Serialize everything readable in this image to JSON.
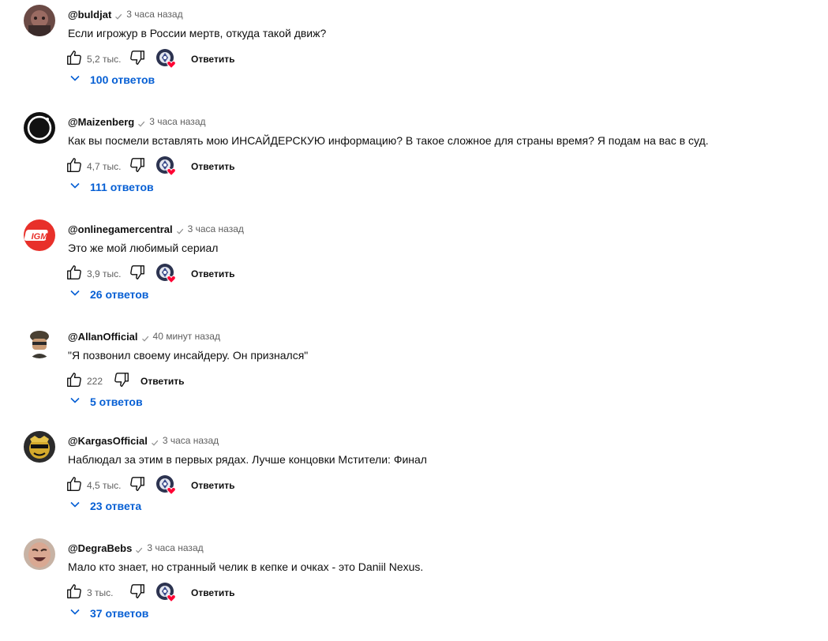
{
  "comments": [
    {
      "author": "@buldjat",
      "time": "3 часа назад",
      "text": "Если игрожур в России мертв, откуда такой движ?",
      "likes": "5,2 тыс.",
      "reply_label": "Ответить",
      "replies_label": "100 ответов",
      "has_heart": true,
      "avatar_icon": "dark-character-avatar"
    },
    {
      "author": "@Maizenberg",
      "time": "3 часа назад",
      "text": "Как вы посмели вставлять мою ИНСАЙДЕРСКУЮ информацию? В такое сложное для страны время? Я подам на вас в суд.",
      "likes": "4,7 тыс.",
      "reply_label": "Ответить",
      "replies_label": "111 ответов",
      "has_heart": true,
      "avatar_icon": "black-ring-avatar"
    },
    {
      "author": "@onlinegamercentral",
      "time": "3 часа назад",
      "text": "Это же мой любимый сериал",
      "likes": "3,9 тыс.",
      "reply_label": "Ответить",
      "replies_label": "26 ответов",
      "has_heart": true,
      "avatar_icon": "igm-logo-avatar"
    },
    {
      "author": "@AllanOfficial",
      "time": "40 минут назад",
      "text": "\"Я позвонил своему инсайдеру. Он признался\"",
      "likes": "222",
      "reply_label": "Ответить",
      "replies_label": "5 ответов",
      "has_heart": false,
      "avatar_icon": "soldier-avatar"
    },
    {
      "author": "@KargasOfficial",
      "time": "3 часа назад",
      "text": "Наблюдал за этим в первых рядах. Лучше концовки Мстители: Финал",
      "likes": "4,5 тыс.",
      "reply_label": "Ответить",
      "replies_label": "23 ответа",
      "has_heart": true,
      "avatar_icon": "cartoon-face-avatar"
    },
    {
      "author": "@DegraBebs",
      "time": "3 часа назад",
      "text": "Мало кто знает, но странный челик в кепке и очках - это Daniil Nexus.",
      "likes": "3 тыс.",
      "reply_label": "Ответить",
      "replies_label": "37 ответов",
      "has_heart": true,
      "avatar_icon": "laughing-face-avatar"
    }
  ],
  "colors": {
    "replies": "#065fd4",
    "meta": "#606060",
    "text": "#0f0f0f",
    "heart": "#ff0033"
  }
}
